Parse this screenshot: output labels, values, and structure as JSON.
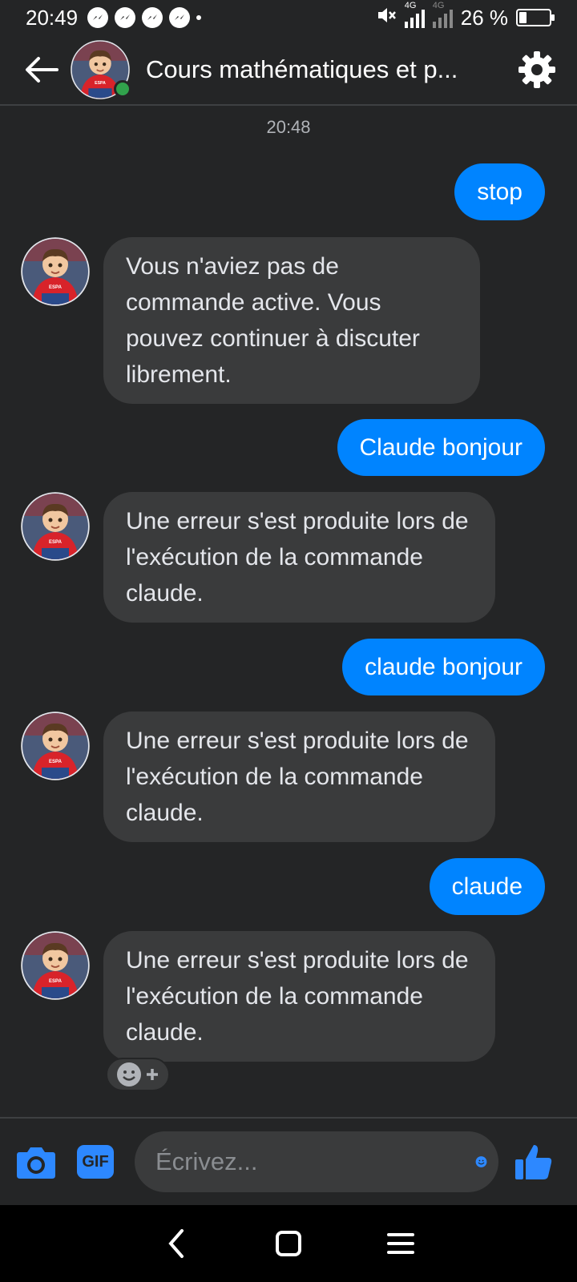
{
  "status_bar": {
    "time": "20:49",
    "network_label_1": "4G",
    "network_label_2": "4G",
    "battery_text": "26 %",
    "battery_level": 0.26
  },
  "header": {
    "title": "Cours mathématiques et p...",
    "online": true
  },
  "chat": {
    "timestamp": "20:48",
    "messages": [
      {
        "side": "out",
        "text": "stop"
      },
      {
        "side": "in",
        "text": "Vous n'aviez pas de commande active. Vous pouvez continuer à discuter librement."
      },
      {
        "side": "out",
        "text": "Claude bonjour"
      },
      {
        "side": "in",
        "text": "Une erreur s'est produite lors de l'exécution de la commande claude."
      },
      {
        "side": "out",
        "text": "claude bonjour"
      },
      {
        "side": "in",
        "text": "Une erreur s'est produite lors de l'exécution de la commande claude."
      },
      {
        "side": "out",
        "text": "claude"
      },
      {
        "side": "in",
        "text": "Une erreur s'est produite lors de l'exécution de la commande claude."
      }
    ]
  },
  "composer": {
    "gif_label": "GIF",
    "placeholder": "Écrivez..."
  },
  "colors": {
    "background": "#242526",
    "outgoing_bubble": "#0084ff",
    "incoming_bubble": "#3a3b3c",
    "accent": "#2d88ff",
    "online": "#31a24c"
  },
  "avatar_logo_text": "ESPA"
}
